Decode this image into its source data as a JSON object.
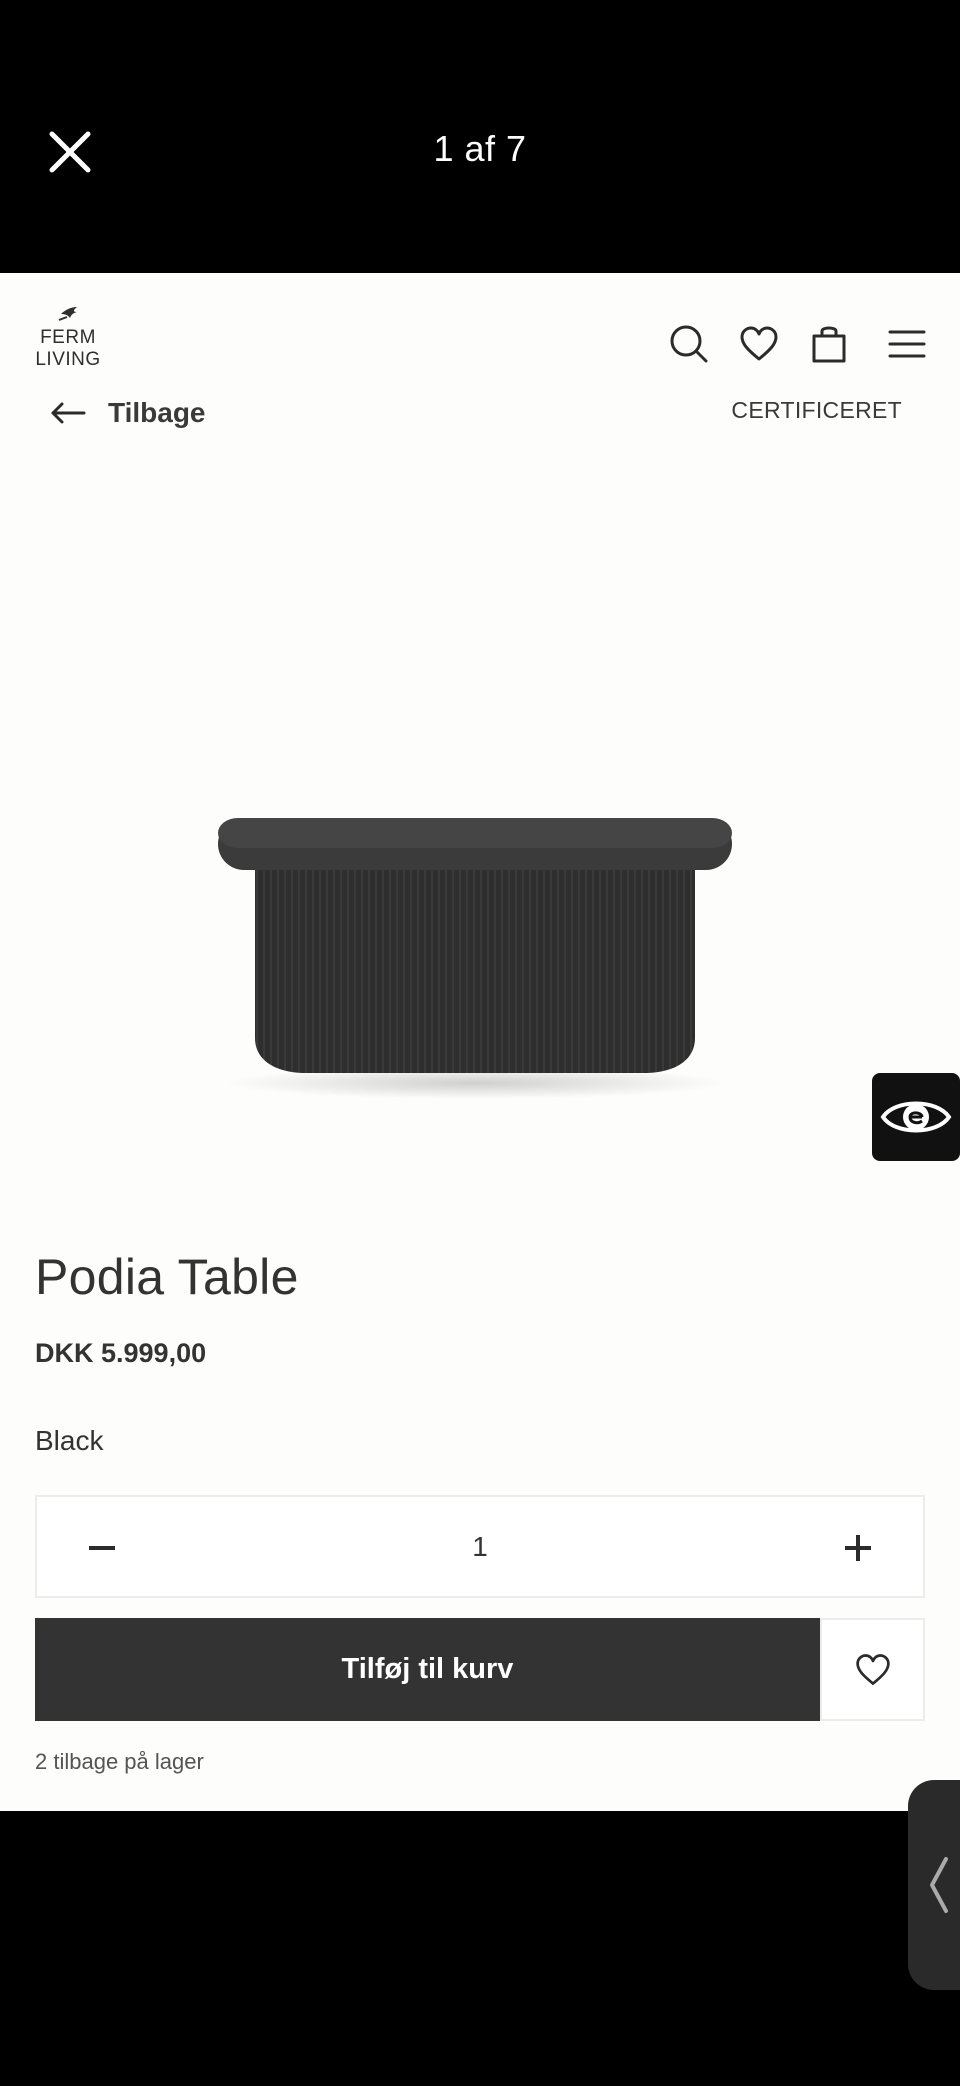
{
  "viewer": {
    "counter": "1 af 7",
    "close_icon": "close-icon"
  },
  "brand": {
    "line1": "FERM",
    "line2": "LIVING"
  },
  "header": {
    "icons": [
      "search-icon",
      "heart-icon",
      "bag-icon",
      "menu-icon"
    ]
  },
  "nav": {
    "back_label": "Tilbage",
    "certified_label": "CERTIFICERET"
  },
  "product": {
    "name": "Podia Table",
    "price": "DKK 5.999,00",
    "variant": "Black",
    "quantity": "1",
    "add_to_cart_label": "Tilføj til kurv",
    "stock_text": "2 tilbage på lager"
  },
  "colors": {
    "accent_dark": "#333333",
    "background": "#fdfdfc"
  }
}
